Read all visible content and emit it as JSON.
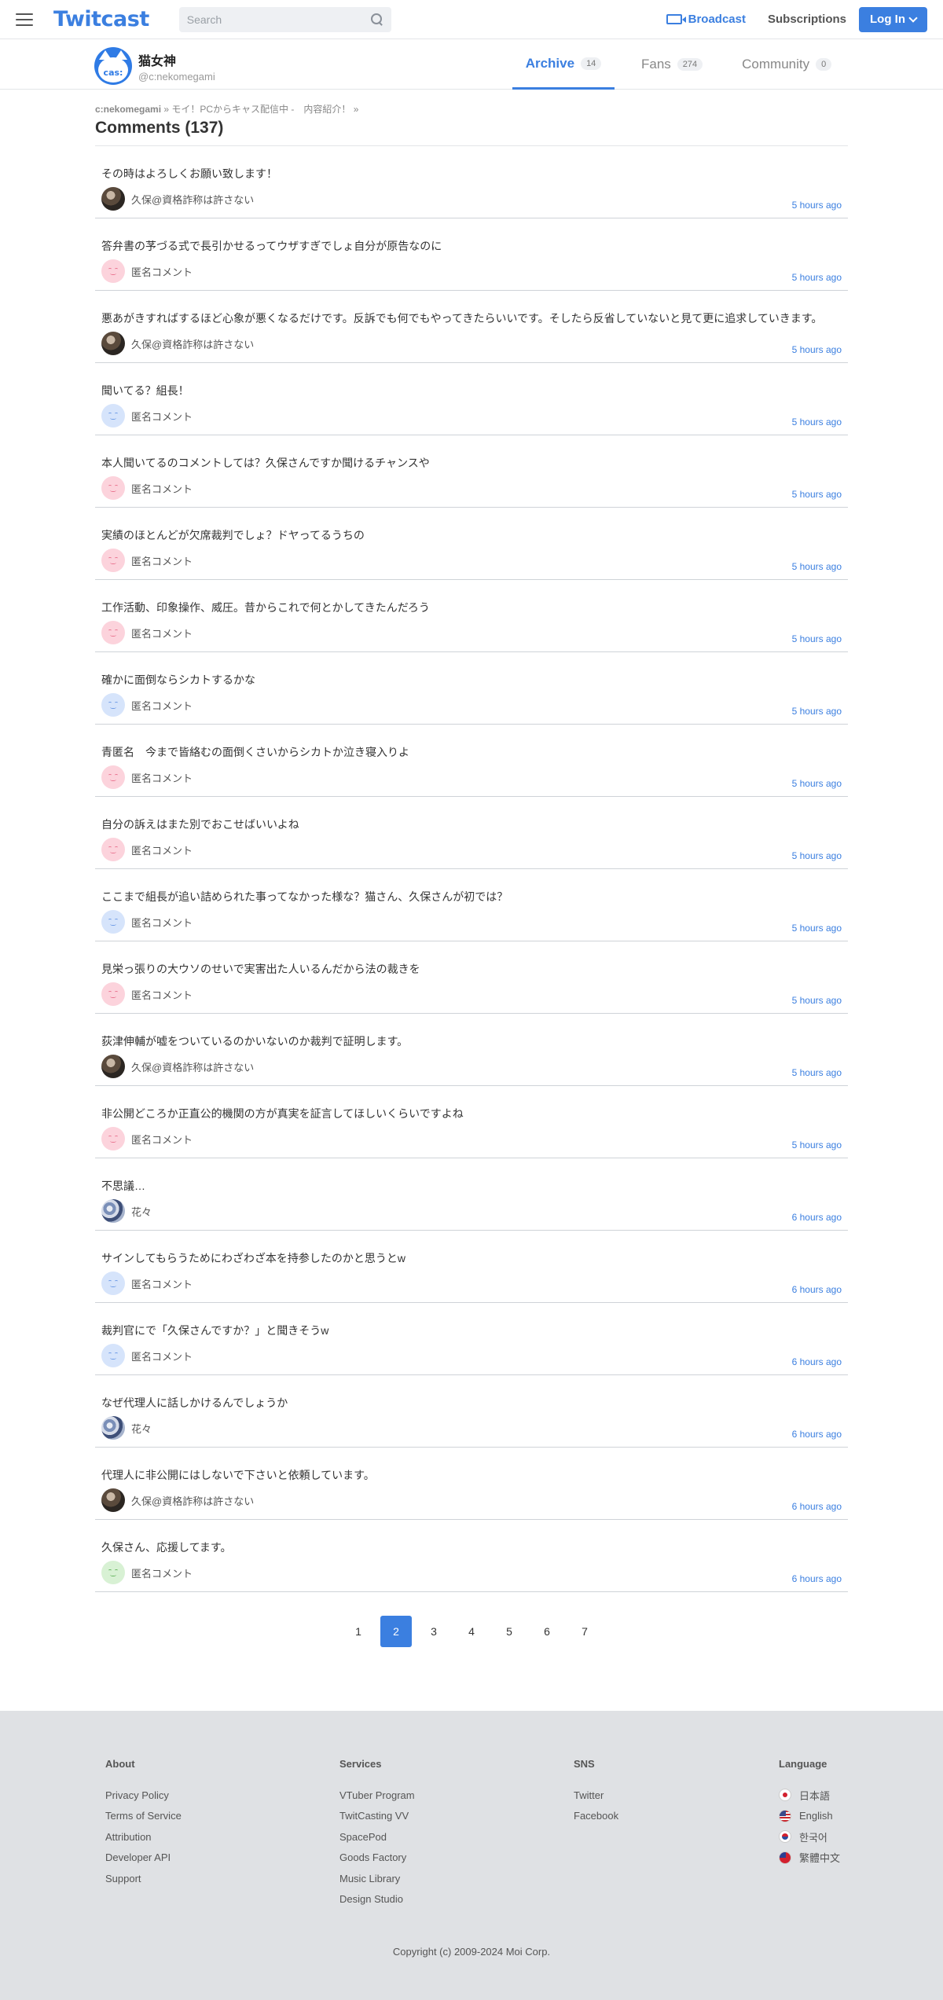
{
  "header": {
    "logo": "Twitcast",
    "search_placeholder": "Search",
    "broadcast": "Broadcast",
    "subscriptions": "Subscriptions",
    "login": "Log In"
  },
  "user": {
    "avatar_text": "cas:",
    "name": "猫女神",
    "id": "@c:nekomegami"
  },
  "tabs": [
    {
      "label": "Archive",
      "count": "14"
    },
    {
      "label": "Fans",
      "count": "274"
    },
    {
      "label": "Community",
      "count": "0"
    }
  ],
  "breadcrumb": {
    "user": "c:nekomegami",
    "sep1": " » ",
    "title": "モイ！PCからキャス配信中 -　内容紹介！",
    "sep2": " »"
  },
  "heading": "Comments (137)",
  "comments": [
    {
      "text": "その時はよろしくお願い致します！",
      "author": "久保@資格詐称は許さない",
      "time": "5 hours ago",
      "avatar": "photo"
    },
    {
      "text": "答弁書の芧づる式で長引かせるってウザすぎでしょ自分が原告なのに",
      "author": "匿名コメント",
      "time": "5 hours ago",
      "avatar": "pink"
    },
    {
      "text": "悪あがきすればするほど心象が悪くなるだけです。反訴でも何でもやってきたらいいです。そしたら反省していないと見て更に追求していきます。",
      "author": "久保@資格詐称は許さない",
      "time": "5 hours ago",
      "avatar": "photo"
    },
    {
      "text": "聞いてる？組長！",
      "author": "匿名コメント",
      "time": "5 hours ago",
      "avatar": "blue"
    },
    {
      "text": "本人聞いてるのコメントしては？久保さんですか聞けるチャンスや",
      "author": "匿名コメント",
      "time": "5 hours ago",
      "avatar": "pink"
    },
    {
      "text": "実績のほとんどが欠席裁判でしょ？ドヤってるうちの",
      "author": "匿名コメント",
      "time": "5 hours ago",
      "avatar": "pink"
    },
    {
      "text": "工作活動、印象操作、威圧。昔からこれで何とかしてきたんだろう",
      "author": "匿名コメント",
      "time": "5 hours ago",
      "avatar": "pink"
    },
    {
      "text": "確かに面倒ならシカトするかな",
      "author": "匿名コメント",
      "time": "5 hours ago",
      "avatar": "blue"
    },
    {
      "text": "青匿名　今まで皆絡むの面倒くさいからシカトか泣き寝入りよ",
      "author": "匿名コメント",
      "time": "5 hours ago",
      "avatar": "pink"
    },
    {
      "text": "自分の訴えはまた別でおこせばいいよね",
      "author": "匿名コメント",
      "time": "5 hours ago",
      "avatar": "pink"
    },
    {
      "text": "ここまで組長が追い詰められた事ってなかった様な？猫さん、久保さんが初では？",
      "author": "匿名コメント",
      "time": "5 hours ago",
      "avatar": "blue"
    },
    {
      "text": "見栄っ張りの大ウソのせいで実害出た人いるんだから法の裁きを",
      "author": "匿名コメント",
      "time": "5 hours ago",
      "avatar": "pink"
    },
    {
      "text": "荻津伸輔が嘘をついているのかいないのか裁判で証明します。",
      "author": "久保@資格詐称は許さない",
      "time": "5 hours ago",
      "avatar": "photo"
    },
    {
      "text": "非公開どころか正直公的機関の方が真実を証言してほしいくらいですよね",
      "author": "匿名コメント",
      "time": "5 hours ago",
      "avatar": "pink"
    },
    {
      "text": "不思議…",
      "author": "花々",
      "time": "6 hours ago",
      "avatar": "flower"
    },
    {
      "text": "サインしてもらうためにわざわざ本を持参したのかと思うとw",
      "author": "匿名コメント",
      "time": "6 hours ago",
      "avatar": "blue"
    },
    {
      "text": "裁判官にで「久保さんですか？」と聞きそうw",
      "author": "匿名コメント",
      "time": "6 hours ago",
      "avatar": "blue"
    },
    {
      "text": "なぜ代理人に話しかけるんでしょうか",
      "author": "花々",
      "time": "6 hours ago",
      "avatar": "flower"
    },
    {
      "text": "代理人に非公開にはしないで下さいと依頼しています。",
      "author": "久保@資格詐称は許さない",
      "time": "6 hours ago",
      "avatar": "photo"
    },
    {
      "text": "久保さん、応援してます。",
      "author": "匿名コメント",
      "time": "6 hours ago",
      "avatar": "green"
    }
  ],
  "pagination": {
    "pages": [
      "1",
      "2",
      "3",
      "4",
      "5",
      "6",
      "7"
    ],
    "current": "2"
  },
  "footer": {
    "about": {
      "title": "About",
      "links": [
        "Privacy Policy",
        "Terms of Service",
        "Attribution",
        "Developer API",
        "Support"
      ]
    },
    "services": {
      "title": "Services",
      "links": [
        "VTuber Program",
        "TwitCasting VV",
        "SpacePod",
        "Goods Factory",
        "Music Library",
        "Design Studio"
      ]
    },
    "sns": {
      "title": "SNS",
      "links": [
        "Twitter",
        "Facebook"
      ]
    },
    "language": {
      "title": "Language",
      "links": [
        "日本語",
        "English",
        "한국어",
        "繁體中文"
      ]
    },
    "copyright": "Copyright (c) 2009-2024 Moi Corp."
  }
}
